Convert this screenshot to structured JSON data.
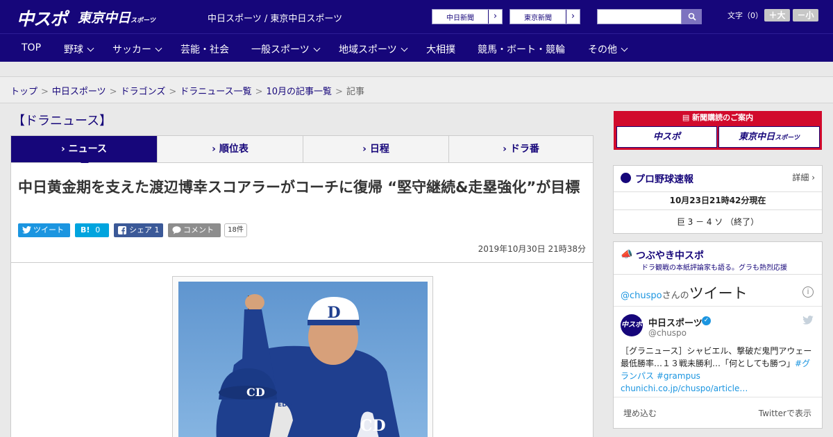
{
  "header": {
    "logo_main": "中スポ",
    "logo_sub": "東京中日",
    "logo_sub_small": "スポーツ",
    "site_name": "中日スポーツ / 東京中日スポーツ",
    "ext_links": [
      {
        "label": "中日新聞",
        "arrow": "›"
      },
      {
        "label": "東京新聞",
        "arrow": "›"
      }
    ],
    "search_placeholder": "",
    "font_size_label": "文字（0）",
    "font_plus": "＋大",
    "font_minus": "－小"
  },
  "nav": [
    {
      "label": "TOP",
      "dropdown": false
    },
    {
      "label": "野球",
      "dropdown": true
    },
    {
      "label": "サッカー",
      "dropdown": true
    },
    {
      "label": "芸能・社会",
      "dropdown": false
    },
    {
      "label": "一般スポーツ",
      "dropdown": true
    },
    {
      "label": "地域スポーツ",
      "dropdown": true
    },
    {
      "label": "大相撲",
      "dropdown": false
    },
    {
      "label": "競馬・ボート・競輪",
      "dropdown": false
    },
    {
      "label": "その他",
      "dropdown": true
    }
  ],
  "breadcrumb": {
    "links": [
      "トップ",
      "中日スポーツ",
      "ドラゴンズ",
      "ドラニュース一覧",
      "10月の記事一覧"
    ],
    "current": "記事",
    "sep": ">"
  },
  "section_title": "【ドラニュース】",
  "tabs": [
    {
      "label": "ニュース",
      "active": true
    },
    {
      "label": "順位表",
      "active": false
    },
    {
      "label": "日程",
      "active": false
    },
    {
      "label": "ドラ番",
      "active": false
    }
  ],
  "article": {
    "headline": "中日黄金期を支えた渡辺博幸スコアラーがコーチに復帰 “堅守継続&走塁強化”が目標",
    "share": {
      "tweet": "ツイート",
      "hatena_count": "0",
      "fb": "シェア 1",
      "comment": "コメント",
      "comment_count": "18件"
    },
    "datetime": "2019年10月30日 21時38分"
  },
  "sidebar": {
    "subscribe": {
      "heading": "新聞購読のご案内",
      "left": "中スポ",
      "right": "東京中日",
      "right_small": "スポーツ"
    },
    "scores": {
      "title": "プロ野球速報",
      "detail": "詳細 ›",
      "updated": "10月23日21時42分現在",
      "game": "巨 3 － 4 ソ （終了）"
    },
    "tweets": {
      "title": "つぶやき中スポ",
      "subtitle": "ドラ観戦の本紙評論家も語る。グラも熱烈応援",
      "handle": "@chuspo",
      "handle_suffix": "さんの",
      "heading": "ツイート",
      "account_name": "中日スポーツ",
      "account_handle": "@chuspo",
      "body": "［グラニュース］シャビエル、撃破だ鬼門アウェー　最低勝率…１３戦未勝利…「何としても勝つ」",
      "hashtags": "#グランパス #grampus",
      "link": "chunichi.co.jp/chuspo/article…",
      "embed": "埋め込む",
      "view": "Twitterで表示"
    }
  },
  "colors": {
    "brand": "#16067a",
    "accent_red": "#d10a2c",
    "twitter": "#1b95e0",
    "hatena": "#00a4de",
    "facebook": "#3b5998"
  }
}
